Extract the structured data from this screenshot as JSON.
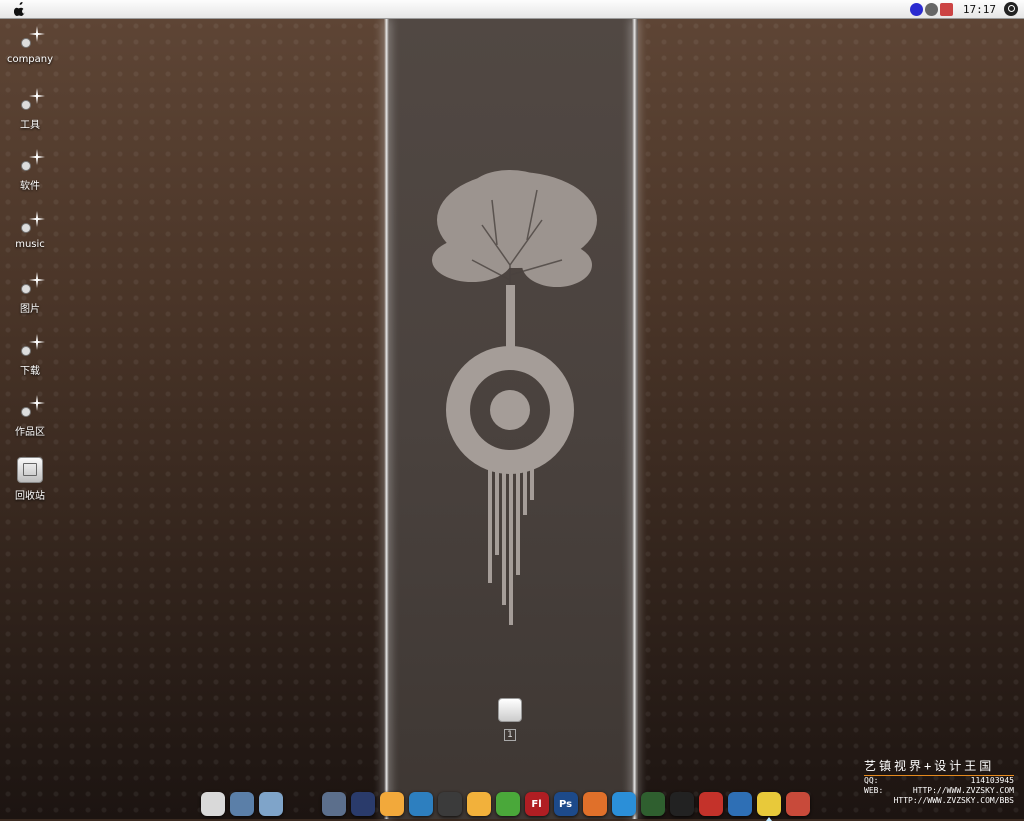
{
  "menubar": {
    "clock": "17:17",
    "tray_icons": [
      "network-icon",
      "gear-icon",
      "user-icon"
    ]
  },
  "desktop_icons": [
    {
      "label": "company",
      "icon": "sparkle-folder-icon"
    },
    {
      "label": "工具",
      "icon": "sparkle-folder-icon"
    },
    {
      "label": "软件",
      "icon": "sparkle-folder-icon"
    },
    {
      "label": "music",
      "icon": "sparkle-folder-icon"
    },
    {
      "label": "图片",
      "icon": "sparkle-folder-icon"
    },
    {
      "label": "下载",
      "icon": "sparkle-folder-icon"
    },
    {
      "label": "作品区",
      "icon": "sparkle-folder-icon"
    },
    {
      "label": "回收站",
      "icon": "recycle-bin-icon"
    }
  ],
  "center_item": {
    "label": "1"
  },
  "dock": {
    "group1": [
      {
        "name": "blank-app-icon",
        "color": "#d9d9d9",
        "text": ""
      },
      {
        "name": "network-app-icon",
        "color": "#5b7fa8",
        "text": ""
      },
      {
        "name": "monitor-app-icon",
        "color": "#7fa4c9",
        "text": ""
      }
    ],
    "group2": [
      {
        "name": "3dsmax-icon",
        "color": "#5c6f8c",
        "text": ""
      },
      {
        "name": "video-app-icon",
        "color": "#2a3b6b",
        "text": ""
      },
      {
        "name": "notes-app-icon",
        "color": "#f2a93b",
        "text": ""
      },
      {
        "name": "spiral-app-icon",
        "color": "#2d7fbf",
        "text": ""
      },
      {
        "name": "cat-app-icon",
        "color": "#3b3b3b",
        "text": ""
      },
      {
        "name": "sun-app-icon",
        "color": "#f2b13b",
        "text": ""
      },
      {
        "name": "green-app-icon",
        "color": "#4aa83a",
        "text": ""
      },
      {
        "name": "flash-icon",
        "color": "#b01e23",
        "text": "Fl"
      },
      {
        "name": "photoshop-icon",
        "color": "#1d4a8a",
        "text": "Ps"
      },
      {
        "name": "orange-app-icon",
        "color": "#e0702a",
        "text": ""
      },
      {
        "name": "ie-browser-icon",
        "color": "#2b8fd8",
        "text": ""
      },
      {
        "name": "windows-app-icon",
        "color": "#2f5f2f",
        "text": ""
      },
      {
        "name": "qq-penguin-icon",
        "color": "#222222",
        "text": ""
      },
      {
        "name": "red-app-icon",
        "color": "#c4322a",
        "text": ""
      },
      {
        "name": "bird-app-icon",
        "color": "#2e6fb5",
        "text": ""
      },
      {
        "name": "yellow-folder-icon",
        "color": "#e8c93a",
        "text": ""
      },
      {
        "name": "tools-app-icon",
        "color": "#c84a3a",
        "text": ""
      }
    ],
    "active_index": 15
  },
  "watermark": {
    "title": "艺镇视界+设计王国",
    "rows": [
      [
        "QQ:",
        "114103945"
      ],
      [
        "WEB:",
        "HTTP://WWW.ZVZSKY.COM"
      ],
      [
        "",
        "HTTP://WWW.ZVZSKY.COM/BBS"
      ]
    ]
  }
}
